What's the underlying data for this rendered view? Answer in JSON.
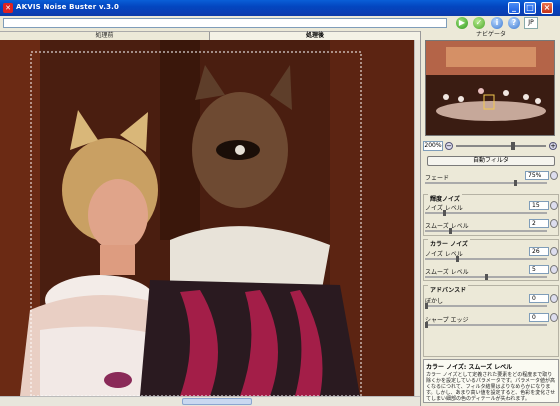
{
  "window": {
    "title": "AKVIS Noise Buster v.3.0"
  },
  "toolbar": {
    "lang": "JP"
  },
  "tabs": {
    "before": "処理前",
    "after": "処理後"
  },
  "navigator": {
    "title": "ナビゲータ",
    "zoom": "200%"
  },
  "buttons": {
    "auto_filter": "自動フィルタ"
  },
  "params": {
    "fade": {
      "label": "フェード",
      "value": "75%",
      "fraction": 0.75
    },
    "luminance_group": "輝度ノイズ",
    "lum_noise": {
      "label": "ノイズ レベル",
      "value": "15",
      "fraction": 0.15
    },
    "lum_smooth": {
      "label": "スムーズ レベル",
      "value": "2",
      "fraction": 0.2
    },
    "color_group": "カラー ノイズ",
    "col_noise": {
      "label": "ノイズ レベル",
      "value": "26",
      "fraction": 0.26
    },
    "col_smooth": {
      "label": "スムーズ レベル",
      "value": "5",
      "fraction": 0.5
    },
    "advanced_group": "アドバンスド",
    "blur": {
      "label": "ぼかし",
      "value": "0",
      "fraction": 0.0
    },
    "sharp_edges": {
      "label": "シャープ エッジ",
      "value": "0",
      "fraction": 0.0
    }
  },
  "help": {
    "title": "カラー ノイズ: スムーズ レベル",
    "body": "カラー ノイズとして定義された要素をどの程度まで取り除くかを設定しているパラメータです。パラメータ値が高くなるにつれて、フィルタ結果はよりなめらかになります。しかし、あまり高い値を設定すると、色彩を変化させてしまい細部の色のディテールが失われます。"
  },
  "colors": {
    "titlebar": "#0a4fd0",
    "accent": "#3a78d0"
  }
}
